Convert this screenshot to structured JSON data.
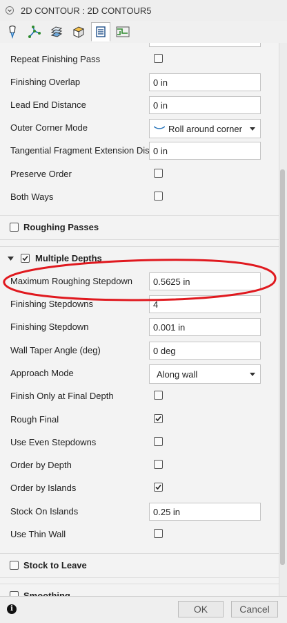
{
  "window": {
    "title": "2D CONTOUR : 2D CONTOUR5"
  },
  "tabs": [
    {
      "name": "tool-tab",
      "icon": "tool-icon"
    },
    {
      "name": "geometry-tab",
      "icon": "geometry-icon"
    },
    {
      "name": "heights-tab",
      "icon": "heights-icon"
    },
    {
      "name": "stock-tab",
      "icon": "stock-icon"
    },
    {
      "name": "passes-tab",
      "icon": "passes-icon",
      "active": true
    },
    {
      "name": "linking-tab",
      "icon": "linking-icon"
    }
  ],
  "fields": {
    "repeat_finishing_pass": {
      "label": "Repeat Finishing Pass",
      "checked": false
    },
    "finishing_overlap": {
      "label": "Finishing Overlap",
      "value": "0 in"
    },
    "lead_end_distance": {
      "label": "Lead End Distance",
      "value": "0 in"
    },
    "outer_corner_mode": {
      "label": "Outer Corner Mode",
      "value": "Roll around corner",
      "icon": "roll-corner-icon"
    },
    "tangential_extension": {
      "label": "Tangential Fragment Extension Dis...",
      "value": "0 in"
    },
    "preserve_order": {
      "label": "Preserve Order",
      "checked": false
    },
    "both_ways": {
      "label": "Both Ways",
      "checked": false
    },
    "max_roughing_stepdown": {
      "label": "Maximum Roughing Stepdown",
      "value": "0.5625 in"
    },
    "finishing_stepdowns": {
      "label": "Finishing Stepdowns",
      "value": "4"
    },
    "finishing_stepdown": {
      "label": "Finishing Stepdown",
      "value": "0.001 in"
    },
    "wall_taper_angle": {
      "label": "Wall Taper Angle (deg)",
      "value": "0 deg"
    },
    "approach_mode": {
      "label": "Approach Mode",
      "value": "Along wall"
    },
    "finish_only_final_depth": {
      "label": "Finish Only at Final Depth",
      "checked": false
    },
    "rough_final": {
      "label": "Rough Final",
      "checked": true
    },
    "use_even_stepdowns": {
      "label": "Use Even Stepdowns",
      "checked": false
    },
    "order_by_depth": {
      "label": "Order by Depth",
      "checked": false
    },
    "order_by_islands": {
      "label": "Order by Islands",
      "checked": true
    },
    "stock_on_islands": {
      "label": "Stock On Islands",
      "value": "0.25 in"
    },
    "use_thin_wall": {
      "label": "Use Thin Wall",
      "checked": false
    }
  },
  "sections": {
    "roughing_passes": {
      "label": "Roughing Passes",
      "checked": false
    },
    "multiple_depths": {
      "label": "Multiple Depths",
      "checked": true,
      "expanded": true
    },
    "stock_to_leave": {
      "label": "Stock to Leave",
      "checked": false
    },
    "smoothing": {
      "label": "Smoothing",
      "checked": false
    }
  },
  "footer": {
    "ok_label": "OK",
    "cancel_label": "Cancel"
  },
  "annotation": {
    "color": "#e0191f"
  }
}
